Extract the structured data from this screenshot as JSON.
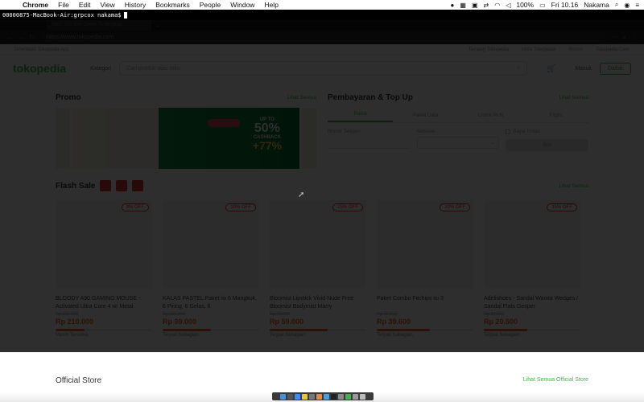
{
  "menubar": {
    "app": "Chrome",
    "items": [
      "File",
      "Edit",
      "View",
      "History",
      "Bookmarks",
      "People",
      "Window",
      "Help"
    ],
    "battery": "100%",
    "clock": "Fri 10.16",
    "user": "Nakama"
  },
  "terminal": {
    "prompt": "00000875-MacBook-Air:grpcox nakama$"
  },
  "browser": {
    "tab_title": "Situs Jual Beli Online Terlengkap...",
    "url": "https://www.tokopedia.com"
  },
  "page": {
    "topstrip": {
      "left": "Download Tokopedia App",
      "links": [
        "Tentang Tokopedia",
        "Mitra Tokopedia",
        "Promo",
        "Tokopedia Care"
      ]
    },
    "header": {
      "logo": "tokopedia",
      "kategori": "Kategori",
      "search_placeholder": "Cari produk atau toko",
      "masuk": "Masuk",
      "daftar": "Daftar"
    },
    "promo": {
      "title": "Promo",
      "link": "Lihat Semua",
      "banner": {
        "up_to": "UP TO",
        "pct": "50%",
        "cashback": "CASHBACK",
        "pct2": "+77%"
      }
    },
    "topup": {
      "title": "Pembayaran & Top Up",
      "link": "Lihat Semua",
      "tabs": [
        "Pulsa",
        "Paket Data",
        "Listrik PLN",
        "Flight"
      ],
      "nomor_label": "Nomor Telepon",
      "nominal_label": "Nominal",
      "bayar_instan": "Bayar Instan",
      "beli": "Beli"
    },
    "flash_sale": {
      "title": "Flash Sale",
      "link": "Lihat Semua",
      "products": [
        {
          "discount": "9% OFF",
          "name": "BLOODY A90 GAMING MOUSE - Activated Ultra Core 4 w/ Metal",
          "old": "Rp 230.000",
          "price": "Rp 210.000",
          "status": "Masih Tersedia",
          "sold": 0.3
        },
        {
          "discount": "10% OFF",
          "name": "KALAS PASTEL Paket isi 6 Mangkuk, 6 Piring, 6 Gelas, 6",
          "old": "Rp 110.000",
          "price": "Rp 99.000",
          "status": "Terjual Sebagian",
          "sold": 0.5
        },
        {
          "discount": "25% OFF",
          "name": "Bloomist Lipstick Vivid Nude Free Bloomist Bodymist Marry",
          "old": "Rp 79.000",
          "price": "Rp 59.000",
          "status": "Terjual Sebagian",
          "sold": 0.6
        },
        {
          "discount": "20% OFF",
          "name": "Paket Combo Fitchips isi 3",
          "old": "Rp 49.500",
          "price": "Rp 39.600",
          "status": "Terjual Sebagian",
          "sold": 0.55
        },
        {
          "discount": "15% OFF",
          "name": "Adelishoes - Sandal Wanita Wedges / Sandal Flats Gesper",
          "old": "Rp 24.000",
          "price": "Rp 20.500",
          "status": "Terjual Sebagian",
          "sold": 0.45
        }
      ]
    },
    "official": {
      "title": "Official Store",
      "link": "Lihat Semua Official Store"
    }
  },
  "colors": {
    "brand": "#42b549",
    "price": "#f25d22",
    "flash": "#d0342c"
  }
}
